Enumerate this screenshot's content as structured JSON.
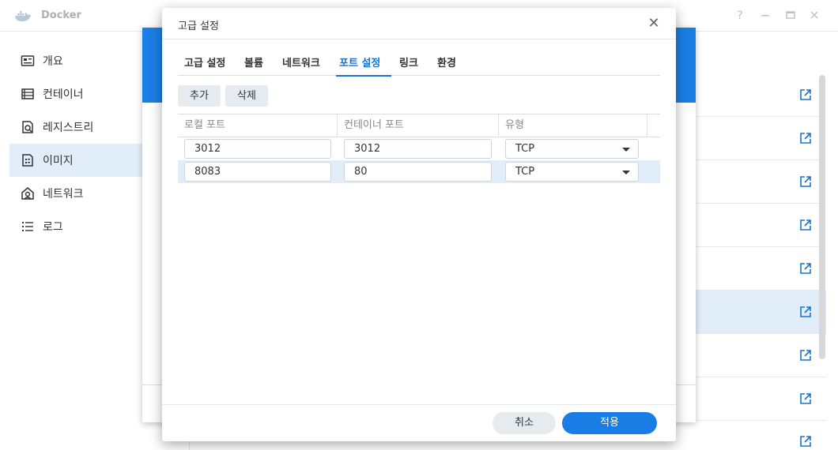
{
  "app": {
    "title": "Docker",
    "help_label": "?"
  },
  "sidebar": {
    "items": [
      {
        "label": "개요",
        "icon": "overview-icon"
      },
      {
        "label": "컨테이너",
        "icon": "container-icon"
      },
      {
        "label": "레지스트리",
        "icon": "registry-icon"
      },
      {
        "label": "이미지",
        "icon": "image-icon",
        "active": true
      },
      {
        "label": "네트워크",
        "icon": "network-icon"
      },
      {
        "label": "로그",
        "icon": "log-icon"
      }
    ]
  },
  "dialog": {
    "title": "고급 설정",
    "close_glyph": "✕",
    "tabs": [
      {
        "label": "고급 설정"
      },
      {
        "label": "볼륨"
      },
      {
        "label": "네트워크"
      },
      {
        "label": "포트 설정",
        "active": true
      },
      {
        "label": "링크"
      },
      {
        "label": "환경"
      }
    ],
    "toolbar": {
      "add_label": "추가",
      "delete_label": "삭제"
    },
    "grid": {
      "columns": [
        "로컬 포트",
        "컨테이너 포트",
        "유형"
      ],
      "rows": [
        {
          "local_port": "3012",
          "container_port": "3012",
          "type": "TCP",
          "selected": false
        },
        {
          "local_port": "8083",
          "container_port": "80",
          "type": "TCP",
          "selected": true
        }
      ]
    },
    "footer": {
      "cancel_label": "취소",
      "apply_label": "적용"
    }
  },
  "colors": {
    "accent": "#1a7de5",
    "selection": "#e1edf9",
    "underlying_header": "#1b7ee6"
  }
}
